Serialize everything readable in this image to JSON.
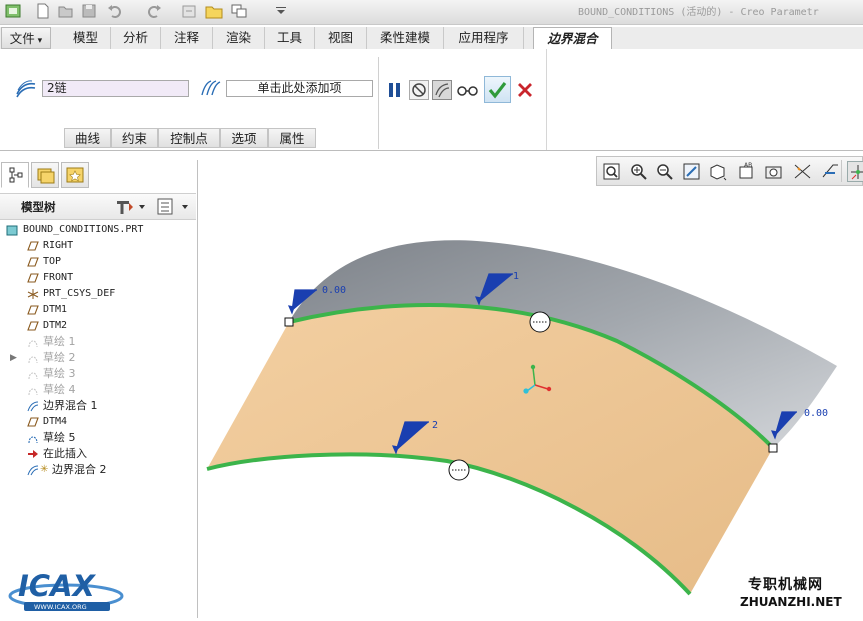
{
  "window": {
    "title": "BOUND_CONDITIONS (活动的) - Creo Parametr"
  },
  "quick_access": {
    "icons": [
      "app-icon",
      "new-icon",
      "open-icon",
      "save-icon",
      "undo-icon",
      "redo-icon",
      "regenerate-icon",
      "folder-icon",
      "windows-icon",
      "customize-icon"
    ]
  },
  "menu": {
    "file_label": "文件",
    "tabs": [
      "模型",
      "分析",
      "注释",
      "渲染",
      "工具",
      "视图",
      "柔性建模",
      "应用程序"
    ],
    "active_tab": "边界混合"
  },
  "ribbon": {
    "first_direction_value": "2链",
    "second_direction_placeholder": "单击此处添加项",
    "group_tabs": [
      "曲线",
      "约束",
      "控制点",
      "选项",
      "属性"
    ]
  },
  "left_panel": {
    "tree_title": "模型树",
    "tree_items": [
      {
        "label": "BOUND_CONDITIONS.PRT",
        "icon": "part-icon",
        "mono": true,
        "dim": false
      },
      {
        "label": "RIGHT",
        "icon": "datum-plane-icon",
        "mono": true,
        "dim": false
      },
      {
        "label": "TOP",
        "icon": "datum-plane-icon",
        "mono": true,
        "dim": false
      },
      {
        "label": "FRONT",
        "icon": "datum-plane-icon",
        "mono": true,
        "dim": false
      },
      {
        "label": "PRT_CSYS_DEF",
        "icon": "csys-icon",
        "mono": true,
        "dim": false
      },
      {
        "label": "DTM1",
        "icon": "datum-plane-icon",
        "mono": true,
        "dim": false
      },
      {
        "label": "DTM2",
        "icon": "datum-plane-icon",
        "mono": true,
        "dim": false
      },
      {
        "label": "草绘 1",
        "icon": "sketch-icon",
        "mono": false,
        "dim": true
      },
      {
        "label": "草绘 2",
        "icon": "sketch-icon",
        "mono": false,
        "dim": true
      },
      {
        "label": "草绘 3",
        "icon": "sketch-icon",
        "mono": false,
        "dim": true
      },
      {
        "label": "草绘 4",
        "icon": "sketch-icon",
        "mono": false,
        "dim": true
      },
      {
        "label": "边界混合 1",
        "icon": "boundary-blend-icon",
        "mono": false,
        "dim": false
      },
      {
        "label": "DTM4",
        "icon": "datum-plane-icon",
        "mono": true,
        "dim": false
      },
      {
        "label": "草绘 5",
        "icon": "sketch-icon",
        "mono": false,
        "dim": false
      },
      {
        "label": "在此插入",
        "icon": "insert-here-arrow-icon",
        "mono": false,
        "dim": false
      },
      {
        "label": "边界混合 2",
        "icon": "boundary-blend-icon",
        "mono": false,
        "dim": false
      }
    ]
  },
  "graphics_toolbar": {
    "icons": [
      "refit-icon",
      "zoom-in-icon",
      "zoom-out-icon",
      "repaint-icon",
      "display-style-icon",
      "saved-views-icon",
      "view-manager-icon",
      "perspective-icon",
      "datum-display-icon",
      "spin-center-icon",
      "annotation-display-icon"
    ]
  },
  "viewport": {
    "edge_label_1": "1",
    "edge_label_2": "2",
    "constraint_left": "0.00",
    "constraint_right": "0.00",
    "surface_color_existing": "#8f949a",
    "surface_color_new": "#f0c896",
    "curve_color": "#3cb44b"
  },
  "watermark": {
    "logo_text": "ICAX",
    "logo_subtext": "WWW.ICAX.ORG",
    "site_cn": "专职机械网",
    "site_url": "ZHUANZHI.NET"
  }
}
